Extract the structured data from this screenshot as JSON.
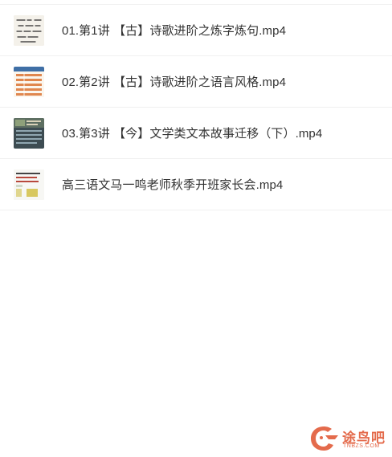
{
  "files": [
    {
      "name": "01.第1讲 【古】诗歌进阶之炼字炼句.mp4",
      "thumbnail_icon": "calligraphy-video-thumbnail-icon"
    },
    {
      "name": "02.第2讲 【古】诗歌进阶之语言风格.mp4",
      "thumbnail_icon": "table-slide-video-thumbnail-icon"
    },
    {
      "name": "03.第3讲 【今】文学类文本故事迁移（下）.mp4",
      "thumbnail_icon": "photo-slide-video-thumbnail-icon"
    },
    {
      "name": "高三语文马一鸣老师秋季开班家长会.mp4",
      "thumbnail_icon": "doc-slide-video-thumbnail-icon"
    }
  ],
  "watermark": {
    "text": "途鸟吧",
    "url": "TNBZS.COM",
    "color": "#e46b4c"
  }
}
